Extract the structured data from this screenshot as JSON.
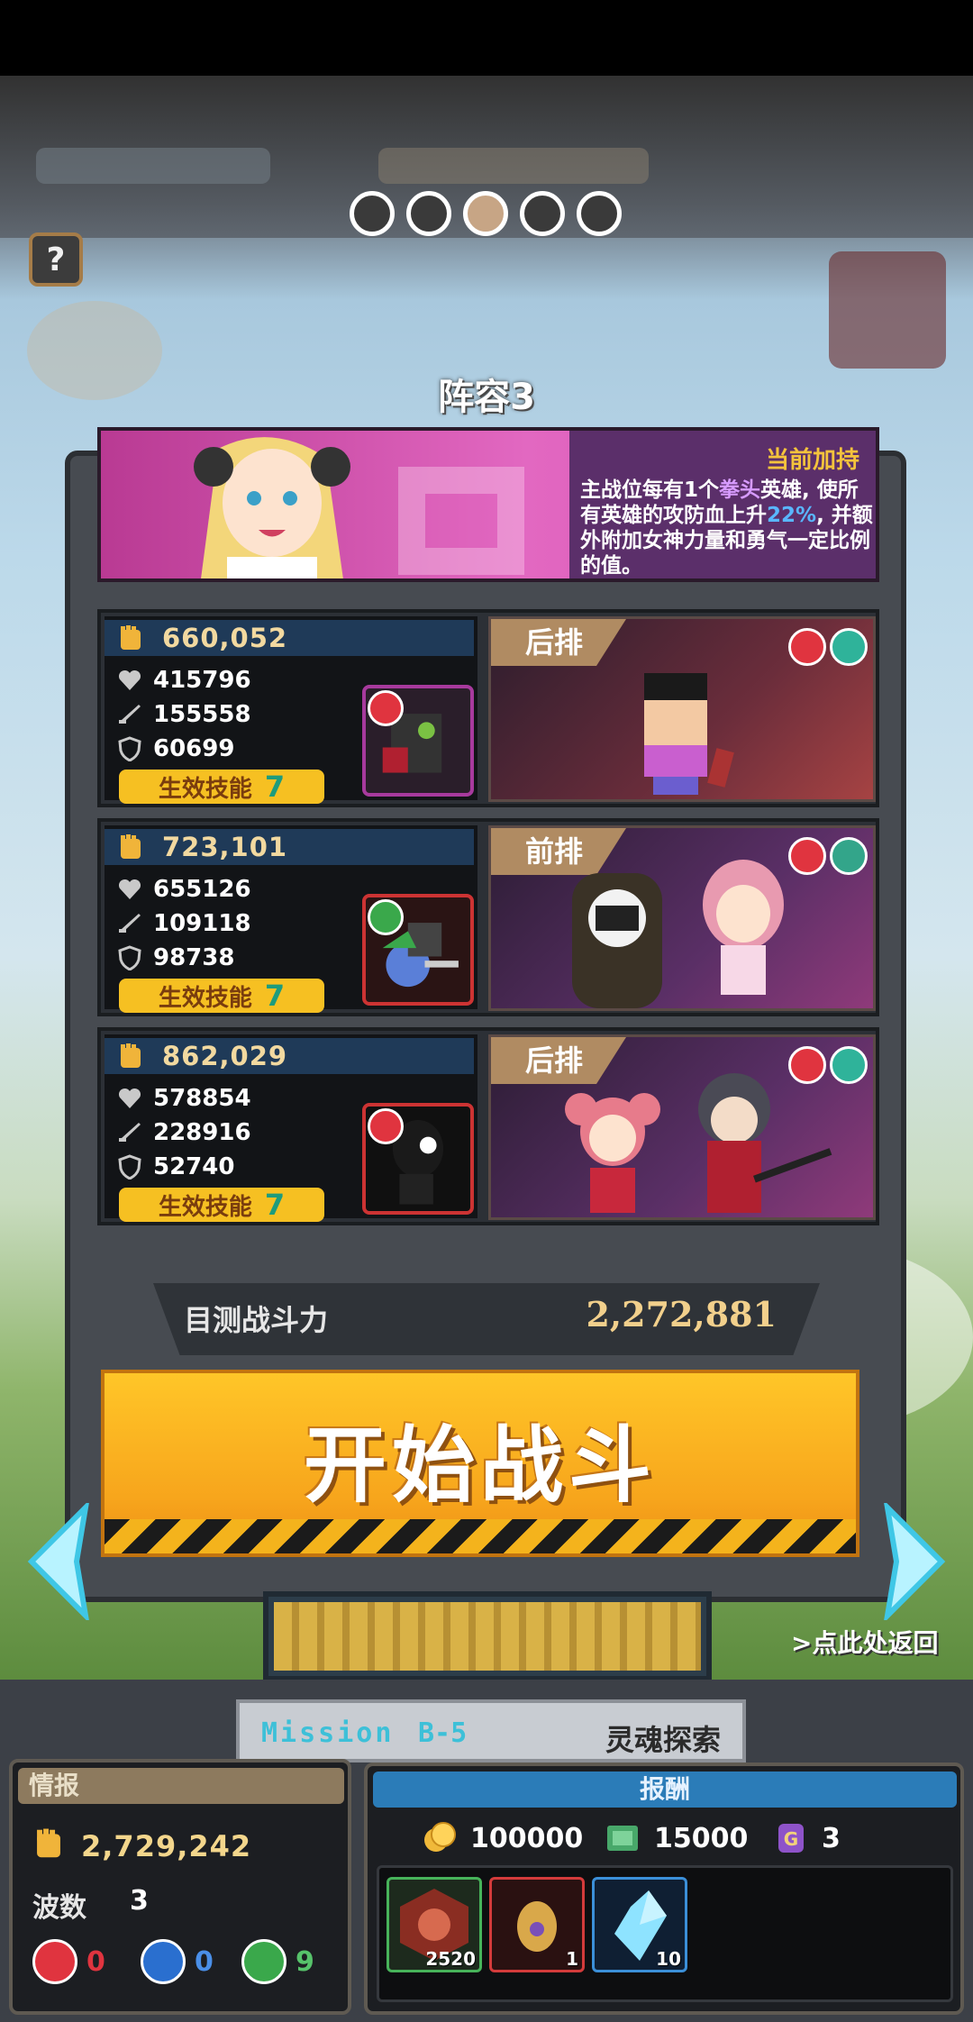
{
  "top_dots": {
    "count": 5,
    "active_index": 2
  },
  "help_button": "?",
  "team_title": "阵容3",
  "bonus": {
    "heading": "当前加持",
    "text_part1": "主战位每有1个",
    "text_keyword": "拳头",
    "text_part2": "英雄, 使所有英雄的攻防血上升",
    "text_percent": "22%",
    "text_part3": ", 并额外附加女神力量和勇气一定比例的值。"
  },
  "slots": [
    {
      "power": "660,052",
      "hp": "415796",
      "atk": "155558",
      "def": "60699",
      "skill_label": "生效技能",
      "skill_count": "7",
      "position": "后排"
    },
    {
      "power": "723,101",
      "hp": "655126",
      "atk": "109118",
      "def": "98738",
      "skill_label": "生效技能",
      "skill_count": "7",
      "position": "前排"
    },
    {
      "power": "862,029",
      "hp": "578854",
      "atk": "228916",
      "def": "52740",
      "skill_label": "生效技能",
      "skill_count": "7",
      "position": "后排"
    }
  ],
  "combat_power": {
    "label": "目测战斗力",
    "value": "2,272,881"
  },
  "start_button": "开始战斗",
  "return_link": ">点此处返回",
  "mission": {
    "label": "Mission",
    "code": "B-5",
    "name": "灵魂探索"
  },
  "info": {
    "heading": "情报",
    "power": "2,729,242",
    "wave_label": "波数",
    "wave": "3",
    "counters": [
      {
        "type": "rock",
        "value": "0",
        "color": "#e0343f"
      },
      {
        "type": "scissors",
        "value": "0",
        "color": "#2a6fcf"
      },
      {
        "type": "paper",
        "value": "9",
        "color": "#3aa84b"
      }
    ]
  },
  "rewards": {
    "heading": "报酬",
    "gold": "100000",
    "cash": "15000",
    "token": "3",
    "items": [
      {
        "name": "chip-item",
        "count": "2520"
      },
      {
        "name": "egg-item",
        "count": "1"
      },
      {
        "name": "crystal-item",
        "count": "10"
      }
    ]
  }
}
